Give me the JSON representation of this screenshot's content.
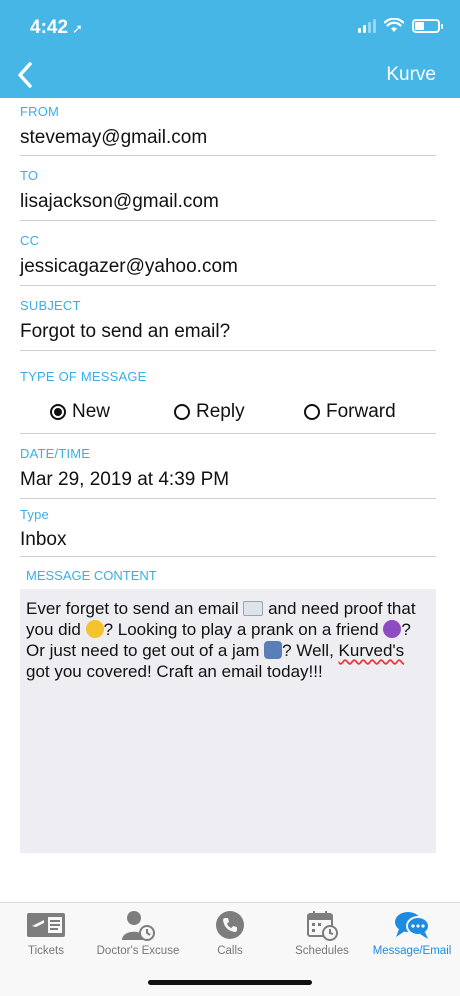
{
  "status": {
    "time": "4:42",
    "location_icon": "location-arrow-icon"
  },
  "nav": {
    "back_icon": "chevron-left-icon",
    "right_label": "Kurve"
  },
  "form": {
    "from": {
      "label": "FROM",
      "value": "stevemay@gmail.com"
    },
    "to": {
      "label": "TO",
      "value": "lisajackson@gmail.com"
    },
    "cc": {
      "label": "CC",
      "value": "jessicagazer@yahoo.com"
    },
    "subject": {
      "label": "SUBJECT",
      "value": "Forgot to send an email?"
    },
    "type_of_message": {
      "label": "TYPE OF MESSAGE",
      "options": [
        "New",
        "Reply",
        "Forward"
      ],
      "selected": "New"
    },
    "datetime": {
      "label": "DATE/TIME",
      "value": "Mar 29, 2019 at 4:39 PM"
    },
    "type": {
      "label": "Type",
      "value": "Inbox"
    },
    "message": {
      "label": "MESSAGE CONTENT",
      "part1": "Ever forget to send an email",
      "part2": "and need proof that you did",
      "part3": "? Looking to play a prank on a friend",
      "part4": "? Or just need to get out of a jam",
      "part5": "? Well,",
      "part6": "Kurved's",
      "part7": "got you covered! Craft an email today!!!"
    }
  },
  "tabs": [
    {
      "label": "Tickets",
      "icon": "ticket-icon"
    },
    {
      "label": "Doctor's Excuse",
      "icon": "doctor-icon"
    },
    {
      "label": "Calls",
      "icon": "phone-icon"
    },
    {
      "label": "Schedules",
      "icon": "calendar-icon"
    },
    {
      "label": "Message/Email",
      "icon": "chat-bubbles-icon",
      "active": true
    }
  ],
  "colors": {
    "header": "#45b6e6",
    "label": "#3aaee6",
    "active_tab": "#1d8ce0"
  }
}
